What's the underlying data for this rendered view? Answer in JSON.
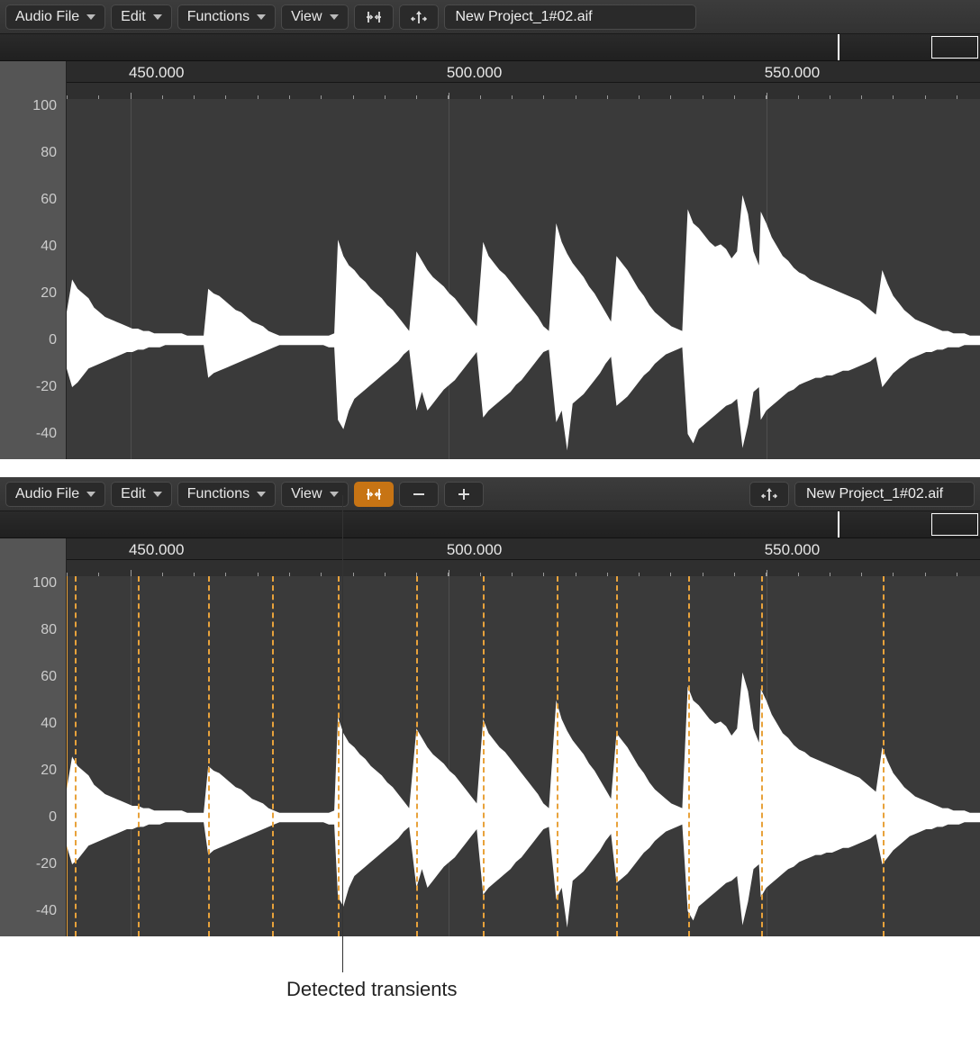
{
  "menus": {
    "audio_file": "Audio File",
    "edit": "Edit",
    "functions": "Functions",
    "view": "View"
  },
  "filename": "New Project_1#02.aif",
  "ruler_ticks": [
    "450.000",
    "500.000",
    "550.000"
  ],
  "ruler_positions_pct": [
    7.0,
    41.8,
    76.6
  ],
  "grid_positions_pct": [
    7.0,
    41.8,
    76.6
  ],
  "y_ticks": [
    "100",
    "80",
    "60",
    "40",
    "20",
    "0",
    "-20",
    "-40"
  ],
  "y_positions_pct": [
    2.0,
    15.0,
    28.0,
    41.0,
    54.0,
    67.0,
    80.0,
    93.0
  ],
  "baseline_pct": 67.0,
  "overview_playhead_pct": 85.5,
  "transient_positions_pct": [
    0.9,
    7.8,
    15.5,
    22.5,
    29.7,
    38.3,
    45.6,
    53.6,
    60.2,
    68.0,
    76.0,
    89.3
  ],
  "callout_label": "Detected transients",
  "waveform_envelope": [
    [
      0.0,
      12,
      -12
    ],
    [
      0.6,
      26,
      -20
    ],
    [
      1.2,
      22,
      -18
    ],
    [
      1.8,
      20,
      -15
    ],
    [
      2.4,
      18,
      -12
    ],
    [
      3.0,
      14,
      -11
    ],
    [
      3.6,
      12,
      -10
    ],
    [
      4.2,
      10,
      -9
    ],
    [
      4.8,
      9,
      -8
    ],
    [
      5.4,
      8,
      -7
    ],
    [
      6.0,
      7,
      -6
    ],
    [
      6.6,
      6,
      -5
    ],
    [
      7.2,
      5,
      -5
    ],
    [
      7.8,
      5,
      -4
    ],
    [
      8.4,
      4,
      -4
    ],
    [
      9.0,
      4,
      -3
    ],
    [
      9.6,
      3,
      -3
    ],
    [
      10.2,
      3,
      -3
    ],
    [
      10.8,
      3,
      -2
    ],
    [
      11.4,
      3,
      -2
    ],
    [
      12.0,
      3,
      -2
    ],
    [
      12.6,
      3,
      -2
    ],
    [
      13.2,
      2,
      -2
    ],
    [
      13.8,
      2,
      -2
    ],
    [
      14.4,
      2,
      -2
    ],
    [
      15.0,
      2,
      -2
    ],
    [
      15.5,
      22,
      -16
    ],
    [
      16.1,
      20,
      -14
    ],
    [
      16.7,
      19,
      -13
    ],
    [
      17.3,
      17,
      -12
    ],
    [
      17.9,
      15,
      -11
    ],
    [
      18.5,
      13,
      -10
    ],
    [
      19.1,
      12,
      -9
    ],
    [
      19.7,
      10,
      -8
    ],
    [
      20.3,
      8,
      -7
    ],
    [
      20.9,
      7,
      -6
    ],
    [
      21.5,
      6,
      -5
    ],
    [
      22.1,
      4,
      -4
    ],
    [
      22.7,
      3,
      -3
    ],
    [
      23.3,
      2,
      -2
    ],
    [
      23.9,
      2,
      -2
    ],
    [
      24.5,
      2,
      -2
    ],
    [
      25.1,
      2,
      -2
    ],
    [
      25.7,
      2,
      -2
    ],
    [
      26.3,
      2,
      -2
    ],
    [
      26.9,
      2,
      -2
    ],
    [
      27.5,
      2,
      -2
    ],
    [
      28.1,
      2,
      -2
    ],
    [
      28.7,
      2,
      -3
    ],
    [
      29.3,
      3,
      -3
    ],
    [
      29.7,
      43,
      -34
    ],
    [
      30.3,
      36,
      -38
    ],
    [
      30.9,
      32,
      -30
    ],
    [
      31.5,
      30,
      -25
    ],
    [
      32.1,
      27,
      -23
    ],
    [
      32.7,
      25,
      -21
    ],
    [
      33.3,
      22,
      -19
    ],
    [
      33.9,
      20,
      -17
    ],
    [
      34.5,
      18,
      -15
    ],
    [
      35.1,
      15,
      -13
    ],
    [
      35.7,
      13,
      -11
    ],
    [
      36.3,
      10,
      -9
    ],
    [
      36.9,
      7,
      -6
    ],
    [
      37.5,
      4,
      -4
    ],
    [
      38.3,
      38,
      -30
    ],
    [
      38.9,
      34,
      -22
    ],
    [
      39.5,
      30,
      -30
    ],
    [
      40.1,
      27,
      -27
    ],
    [
      40.7,
      25,
      -24
    ],
    [
      41.3,
      23,
      -21
    ],
    [
      41.9,
      20,
      -19
    ],
    [
      42.5,
      18,
      -17
    ],
    [
      43.1,
      15,
      -14
    ],
    [
      43.7,
      12,
      -11
    ],
    [
      44.3,
      9,
      -8
    ],
    [
      44.9,
      6,
      -5
    ],
    [
      45.6,
      42,
      -33
    ],
    [
      46.2,
      36,
      -30
    ],
    [
      46.8,
      33,
      -28
    ],
    [
      47.4,
      30,
      -26
    ],
    [
      48.0,
      28,
      -24
    ],
    [
      48.6,
      25,
      -22
    ],
    [
      49.2,
      22,
      -19
    ],
    [
      49.8,
      19,
      -17
    ],
    [
      50.4,
      16,
      -14
    ],
    [
      51.0,
      13,
      -11
    ],
    [
      51.6,
      10,
      -8
    ],
    [
      52.2,
      6,
      -5
    ],
    [
      52.8,
      4,
      -4
    ],
    [
      53.6,
      50,
      -35
    ],
    [
      54.2,
      42,
      -30
    ],
    [
      54.8,
      37,
      -47
    ],
    [
      55.4,
      33,
      -27
    ],
    [
      56.0,
      30,
      -25
    ],
    [
      56.6,
      27,
      -23
    ],
    [
      57.2,
      23,
      -20
    ],
    [
      57.8,
      20,
      -17
    ],
    [
      58.4,
      16,
      -14
    ],
    [
      59.0,
      12,
      -10
    ],
    [
      59.6,
      8,
      -7
    ],
    [
      60.2,
      36,
      -28
    ],
    [
      60.8,
      33,
      -26
    ],
    [
      61.4,
      30,
      -24
    ],
    [
      62.0,
      26,
      -21
    ],
    [
      62.6,
      22,
      -18
    ],
    [
      63.2,
      19,
      -15
    ],
    [
      63.8,
      15,
      -13
    ],
    [
      64.4,
      12,
      -10
    ],
    [
      65.0,
      10,
      -8
    ],
    [
      65.6,
      8,
      -6
    ],
    [
      66.2,
      6,
      -5
    ],
    [
      66.8,
      5,
      -4
    ],
    [
      67.4,
      4,
      -3
    ],
    [
      68.0,
      56,
      -40
    ],
    [
      68.6,
      50,
      -44
    ],
    [
      69.2,
      48,
      -38
    ],
    [
      69.8,
      45,
      -36
    ],
    [
      70.4,
      42,
      -34
    ],
    [
      71.0,
      40,
      -32
    ],
    [
      71.6,
      41,
      -30
    ],
    [
      72.2,
      39,
      -28
    ],
    [
      72.8,
      35,
      -27
    ],
    [
      73.4,
      38,
      -25
    ],
    [
      74.0,
      62,
      -46
    ],
    [
      74.6,
      54,
      -36
    ],
    [
      75.2,
      38,
      -22
    ],
    [
      75.8,
      32,
      -20
    ],
    [
      76.0,
      55,
      -34
    ],
    [
      76.6,
      50,
      -30
    ],
    [
      77.2,
      44,
      -28
    ],
    [
      77.8,
      40,
      -26
    ],
    [
      78.4,
      36,
      -24
    ],
    [
      79.0,
      34,
      -22
    ],
    [
      79.6,
      31,
      -21
    ],
    [
      80.2,
      29,
      -19
    ],
    [
      80.8,
      28,
      -18
    ],
    [
      81.4,
      26,
      -17
    ],
    [
      82.0,
      25,
      -16
    ],
    [
      82.6,
      24,
      -16
    ],
    [
      83.2,
      23,
      -15
    ],
    [
      83.8,
      22,
      -15
    ],
    [
      84.4,
      21,
      -14
    ],
    [
      85.0,
      20,
      -13
    ],
    [
      85.6,
      19,
      -13
    ],
    [
      86.2,
      18,
      -12
    ],
    [
      86.8,
      17,
      -11
    ],
    [
      87.4,
      15,
      -10
    ],
    [
      88.0,
      13,
      -9
    ],
    [
      88.6,
      11,
      -7
    ],
    [
      89.3,
      30,
      -20
    ],
    [
      89.9,
      24,
      -17
    ],
    [
      90.5,
      19,
      -14
    ],
    [
      91.1,
      16,
      -12
    ],
    [
      91.7,
      13,
      -10
    ],
    [
      92.3,
      11,
      -8
    ],
    [
      92.9,
      9,
      -7
    ],
    [
      93.5,
      8,
      -6
    ],
    [
      94.1,
      7,
      -5
    ],
    [
      94.7,
      6,
      -5
    ],
    [
      95.3,
      5,
      -4
    ],
    [
      95.9,
      4,
      -4
    ],
    [
      96.5,
      4,
      -3
    ],
    [
      97.1,
      3,
      -3
    ],
    [
      97.7,
      3,
      -3
    ],
    [
      98.3,
      3,
      -2
    ],
    [
      98.9,
      2,
      -2
    ],
    [
      99.5,
      2,
      -2
    ],
    [
      100,
      2,
      -2
    ]
  ]
}
